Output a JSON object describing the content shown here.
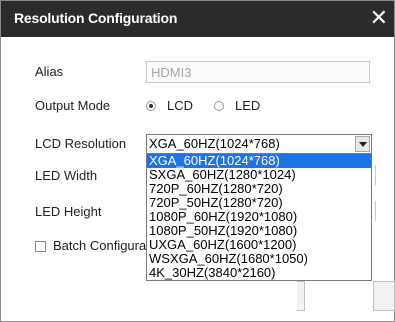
{
  "dialog": {
    "title": "Resolution Configuration",
    "close_glyph": "✕"
  },
  "form": {
    "alias_label": "Alias",
    "alias_value": "HDMI3",
    "output_mode_label": "Output Mode",
    "output_mode_options": [
      {
        "label": "LCD",
        "selected": true
      },
      {
        "label": "LED",
        "selected": false
      }
    ],
    "lcd_resolution_label": "LCD Resolution",
    "lcd_resolution_value": "XGA_60HZ(1024*768)",
    "led_width_label": "LED Width",
    "led_height_label": "LED Height",
    "batch_config_label": "Batch Configura"
  },
  "dropdown": {
    "options": [
      "XGA_60HZ(1024*768)",
      "SXGA_60HZ(1280*1024)",
      "720P_60HZ(1280*720)",
      "720P_50HZ(1280*720)",
      "1080P_60HZ(1920*1080)",
      "1080P_50HZ(1920*1080)",
      "UXGA_60HZ(1600*1200)",
      "WSXGA_60HZ(1680*1050)",
      "4K_30HZ(3840*2160)"
    ],
    "selected_index": 0
  },
  "colors": {
    "titlebar": "#2b2b2b",
    "selection": "#1e73e8"
  },
  "icons": {
    "close": "close-icon",
    "select_arrow": "chevron-down-icon"
  }
}
